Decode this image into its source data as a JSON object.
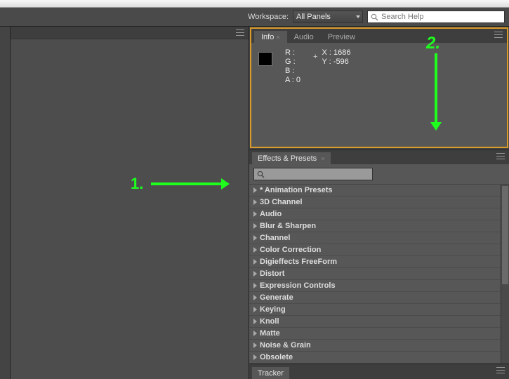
{
  "appbar": {
    "workspace_label": "Workspace:",
    "workspace_value": "All Panels",
    "search_placeholder": "Search Help"
  },
  "info_panel": {
    "tabs": [
      {
        "label": "Info",
        "active": true
      },
      {
        "label": "Audio",
        "active": false
      },
      {
        "label": "Preview",
        "active": false
      }
    ],
    "channels": {
      "R": "",
      "G": "",
      "B": "",
      "A": "0"
    },
    "position": {
      "X": "1686",
      "Y": "-596"
    }
  },
  "effects_panel": {
    "title": "Effects & Presets",
    "search_placeholder": "",
    "items": [
      "* Animation Presets",
      "3D Channel",
      "Audio",
      "Blur & Sharpen",
      "Channel",
      "Color Correction",
      "Digieffects FreeForm",
      "Distort",
      "Expression Controls",
      "Generate",
      "Keying",
      "Knoll",
      "Matte",
      "Noise & Grain",
      "Obsolete"
    ]
  },
  "tracker_panel": {
    "title": "Tracker"
  },
  "annotations": {
    "one": "1.",
    "two": "2."
  }
}
